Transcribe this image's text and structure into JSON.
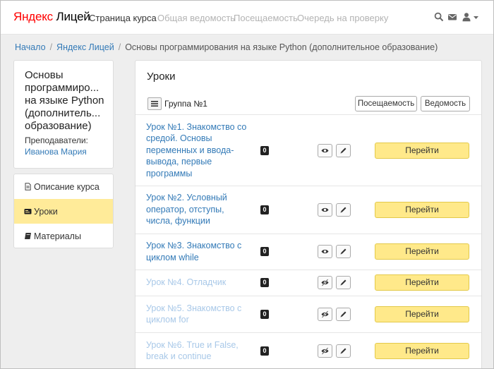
{
  "nav": {
    "logo_brand": "Яндекс",
    "logo_product": "Лицей",
    "links": [
      "Страница курса",
      "Общая ведомость",
      "Посещаемость",
      "Очередь на проверку"
    ]
  },
  "breadcrumb": {
    "home": "Начало",
    "org": "Яндекс Лицей",
    "current": "Основы программирования на языке Python (дополнительное образование)"
  },
  "course": {
    "title_lines": [
      "Основы",
      "программиро...",
      "на языке Python",
      "(дополнитель...",
      "образование)"
    ],
    "teachers_label": "Преподаватели:",
    "teacher_name": "Иванова Мария"
  },
  "menu": [
    {
      "label": "Описание курса",
      "icon": "document-icon",
      "active": false
    },
    {
      "label": "Уроки",
      "icon": "lessons-icon",
      "active": true
    },
    {
      "label": "Материалы",
      "icon": "book-icon",
      "active": false
    }
  ],
  "lessons_panel": {
    "title": "Уроки",
    "group_label": "Группа №1",
    "attendance_button": "Посещаемость",
    "grades_button": "Ведомость",
    "go_label": "Перейти"
  },
  "lessons": [
    {
      "lines": [
        "Урок №1. Знакомство со",
        "средой. Основы",
        "переменных и ввода-",
        "вывода, первые",
        "программы"
      ],
      "count": "0",
      "muted": false,
      "visible": true
    },
    {
      "lines": [
        "Урок №2. Условный",
        "оператор, отступы,",
        "числа, функции"
      ],
      "count": "0",
      "muted": false,
      "visible": true
    },
    {
      "lines": [
        "Урок №3. Знакомство с",
        "циклом while"
      ],
      "count": "0",
      "muted": false,
      "visible": true
    },
    {
      "lines": [
        "Урок №4. Отладчик"
      ],
      "count": "0",
      "muted": true,
      "visible": false
    },
    {
      "lines": [
        "Урок №5. Знакомство с",
        "циклом for"
      ],
      "count": "0",
      "muted": true,
      "visible": false
    },
    {
      "lines": [
        "Урок №6. True и False,",
        "break и continue"
      ],
      "count": "0",
      "muted": true,
      "visible": false
    }
  ],
  "colors": {
    "link": "#337ab7",
    "muted_link": "#a8c8e8",
    "accent": "#ffe98a",
    "active_menu": "#ffeb99"
  }
}
